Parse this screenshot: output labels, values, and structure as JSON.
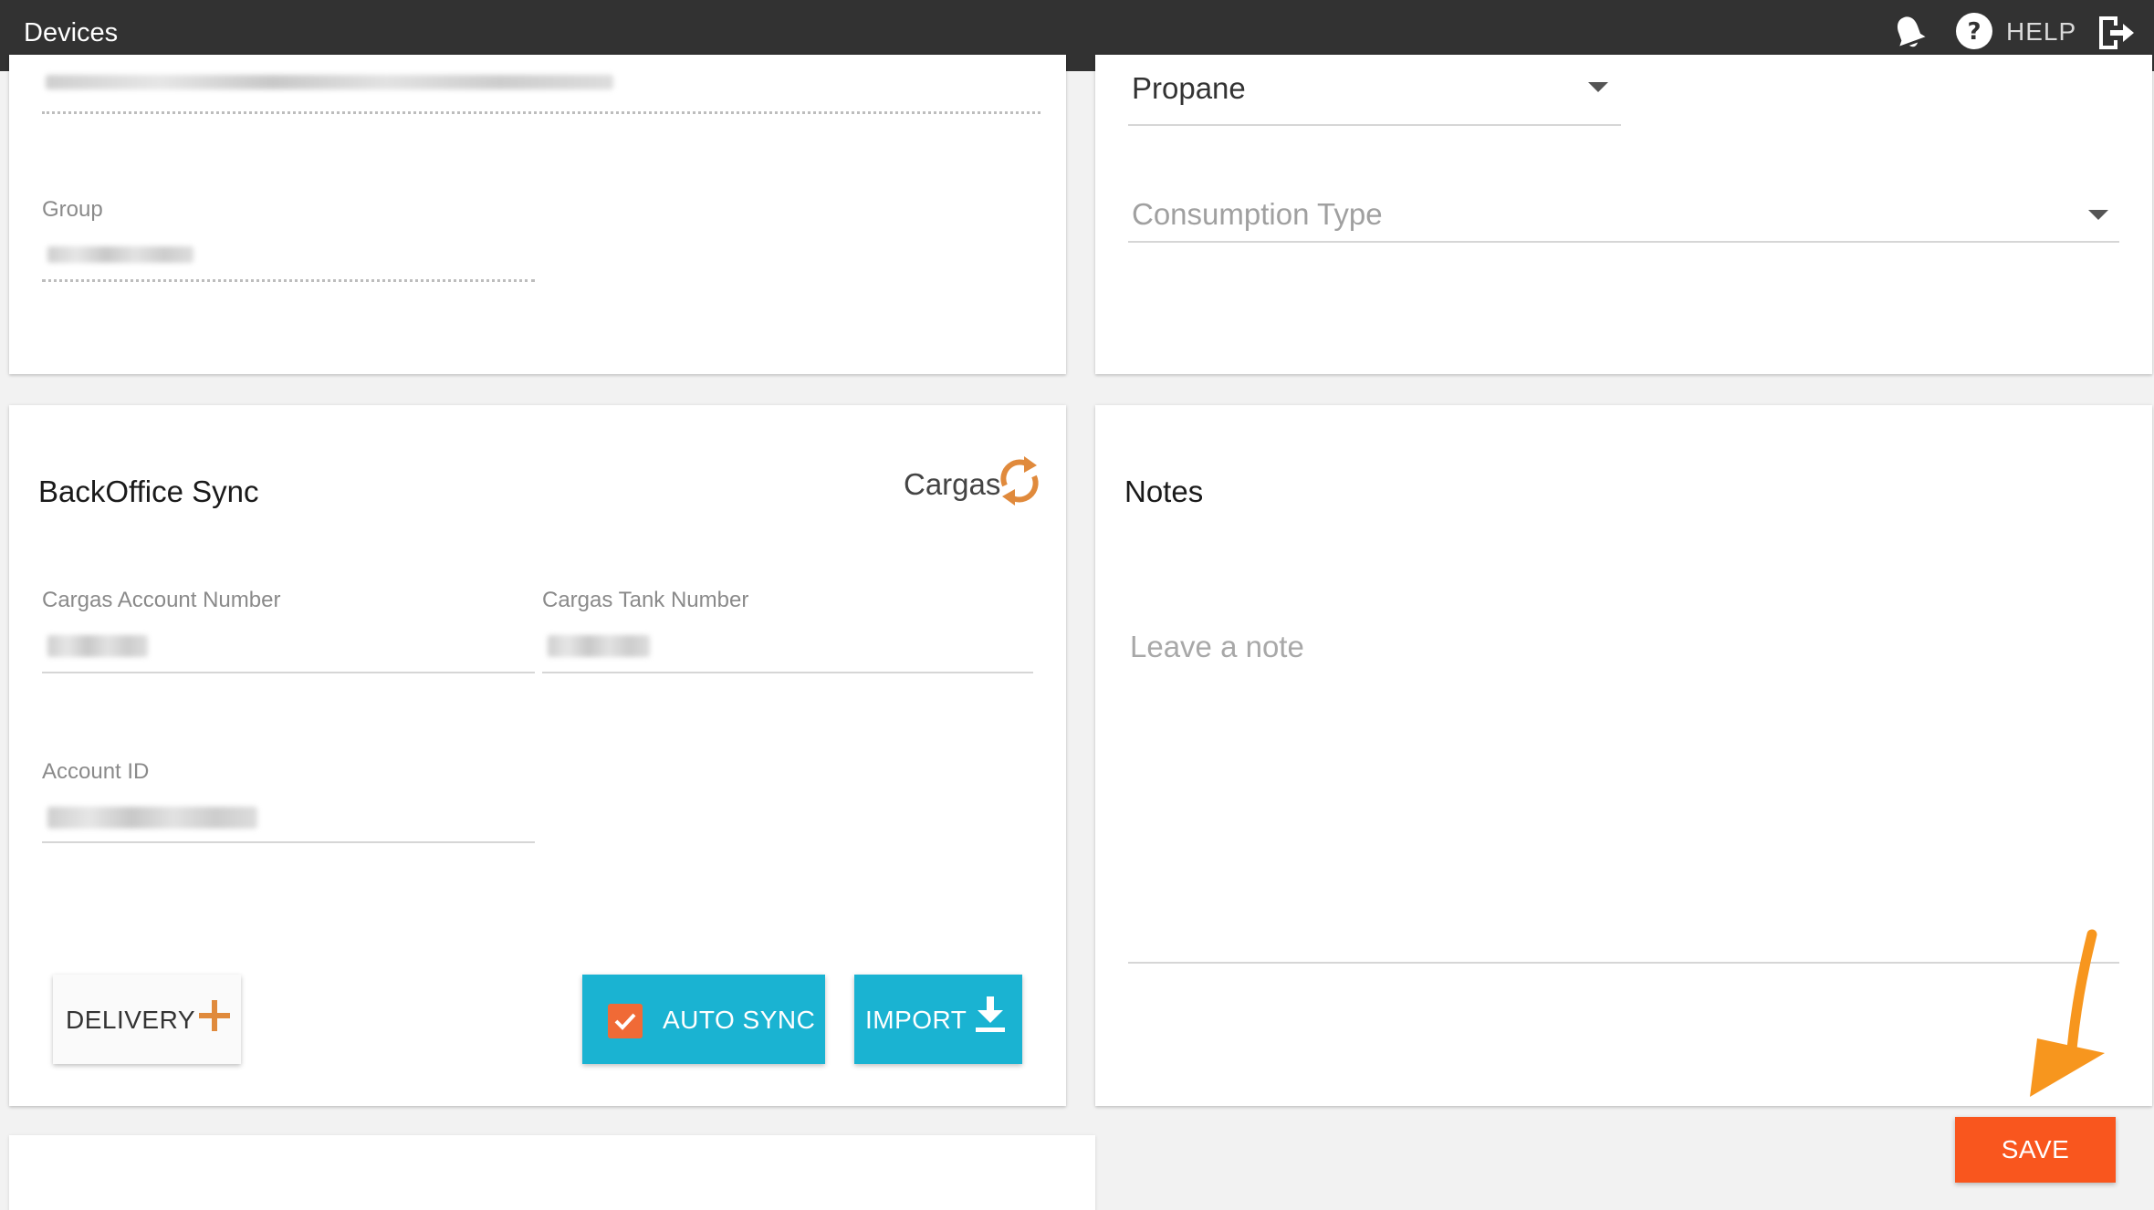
{
  "header": {
    "title": "Devices",
    "help_label": "HELP"
  },
  "top_left_card": {
    "group_label": "Group"
  },
  "top_right_card": {
    "fuel_type_value": "Propane",
    "consumption_type_placeholder": "Consumption Type"
  },
  "backoffice": {
    "title": "BackOffice Sync",
    "provider": "Cargas",
    "account_number_label": "Cargas Account Number",
    "tank_number_label": "Cargas Tank Number",
    "account_id_label": "Account ID",
    "delivery_label": "DELIVERY",
    "auto_sync_label": "AUTO SYNC",
    "auto_sync_checked": true,
    "import_label": "IMPORT"
  },
  "notes": {
    "title": "Notes",
    "placeholder": "Leave a note"
  },
  "save_label": "SAVE",
  "colors": {
    "topbar": "#323232",
    "accent_cyan": "#1ab3d2",
    "accent_orange": "#f9561e",
    "icon_orange": "#e08a3c",
    "annotation_arrow": "#f7961e"
  }
}
